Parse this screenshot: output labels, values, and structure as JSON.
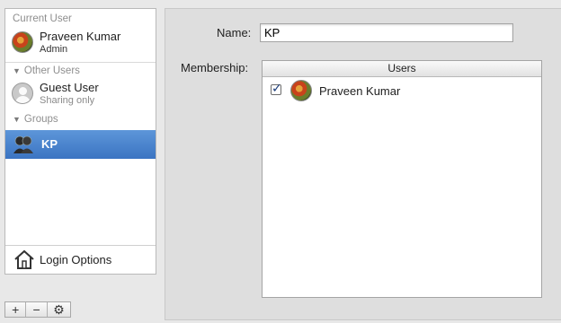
{
  "sidebar": {
    "current_user_header": "Current User",
    "current_user": {
      "name": "Praveen Kumar",
      "role": "Admin",
      "avatar": "parrot-avatar"
    },
    "other_users_header": "Other Users",
    "other_users": [
      {
        "name": "Guest User",
        "detail": "Sharing only",
        "avatar": "guest-avatar"
      }
    ],
    "groups_header": "Groups",
    "groups": [
      {
        "name": "KP",
        "icon": "group-icon",
        "selected": true
      }
    ],
    "login_options_label": "Login Options"
  },
  "toolbar": {
    "add_label": "+",
    "remove_label": "−",
    "action_label": "⚙"
  },
  "detail": {
    "name_label": "Name:",
    "name_value": "KP",
    "membership_label": "Membership:",
    "table": {
      "column_header": "Users",
      "rows": [
        {
          "checked": true,
          "name": "Praveen Kumar",
          "avatar": "parrot-avatar"
        }
      ]
    }
  },
  "colors": {
    "selection": "#3b74c2",
    "main_bg": "#dedede",
    "sidebar_bg": "#ffffff"
  }
}
